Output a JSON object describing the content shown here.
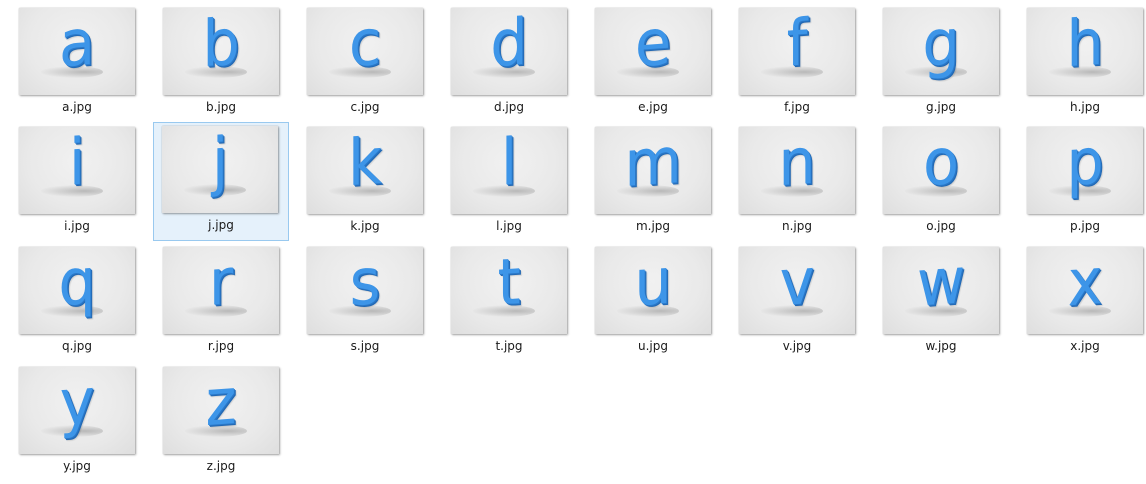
{
  "files": [
    {
      "name": "a.jpg",
      "letter": "a"
    },
    {
      "name": "b.jpg",
      "letter": "b"
    },
    {
      "name": "c.jpg",
      "letter": "c"
    },
    {
      "name": "d.jpg",
      "letter": "d"
    },
    {
      "name": "e.jpg",
      "letter": "e"
    },
    {
      "name": "f.jpg",
      "letter": "f"
    },
    {
      "name": "g.jpg",
      "letter": "g"
    },
    {
      "name": "h.jpg",
      "letter": "h"
    },
    {
      "name": "i.jpg",
      "letter": "i"
    },
    {
      "name": "j.jpg",
      "letter": "j"
    },
    {
      "name": "k.jpg",
      "letter": "k"
    },
    {
      "name": "l.jpg",
      "letter": "l"
    },
    {
      "name": "m.jpg",
      "letter": "m"
    },
    {
      "name": "n.jpg",
      "letter": "n"
    },
    {
      "name": "o.jpg",
      "letter": "o"
    },
    {
      "name": "p.jpg",
      "letter": "p"
    },
    {
      "name": "q.jpg",
      "letter": "q"
    },
    {
      "name": "r.jpg",
      "letter": "r"
    },
    {
      "name": "s.jpg",
      "letter": "s"
    },
    {
      "name": "t.jpg",
      "letter": "t"
    },
    {
      "name": "u.jpg",
      "letter": "u"
    },
    {
      "name": "v.jpg",
      "letter": "v"
    },
    {
      "name": "w.jpg",
      "letter": "w"
    },
    {
      "name": "x.jpg",
      "letter": "x"
    },
    {
      "name": "y.jpg",
      "letter": "y"
    },
    {
      "name": "z.jpg",
      "letter": "z"
    }
  ],
  "selected_file": "j.jpg",
  "colors": {
    "letter_blue": "#3d95e8",
    "selection_fill": "#e5f1fb",
    "selection_border": "#99c9ef"
  }
}
